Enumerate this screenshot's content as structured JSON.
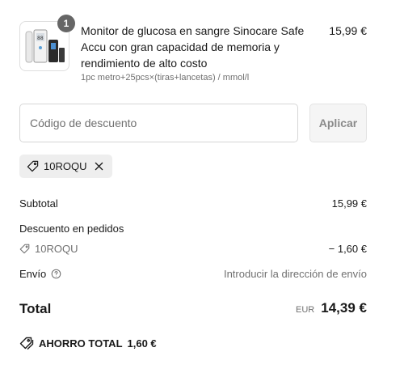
{
  "product": {
    "quantity": "1",
    "title": "Monitor de glucosa en sangre Sinocare Safe Accu con gran capacidad de memoria y rendimiento de alto costo",
    "variant": "1pc metro+25pcs×(tiras+lancetas) / mmol/l",
    "price": "15,99 €",
    "image_icon": "glucose-meter-image"
  },
  "discount": {
    "placeholder": "Código de descuento",
    "apply_label": "Aplicar",
    "applied_code": "10ROQU"
  },
  "summary": {
    "subtotal_label": "Subtotal",
    "subtotal_value": "15,99 €",
    "order_discount_label": "Descuento en pedidos",
    "discount_code": "10ROQU",
    "discount_value": "− 1,60 €",
    "shipping_label": "Envío",
    "shipping_value": "Introducir la dirección de envío",
    "total_label": "Total",
    "currency": "EUR",
    "total_value": "14,39 €",
    "savings_label": "AHORRO TOTAL",
    "savings_value": "1,60 €"
  },
  "colors": {
    "text": "#1a1a1a",
    "muted": "#707070",
    "badge": "#666666",
    "chip_bg": "#eeeeee"
  }
}
